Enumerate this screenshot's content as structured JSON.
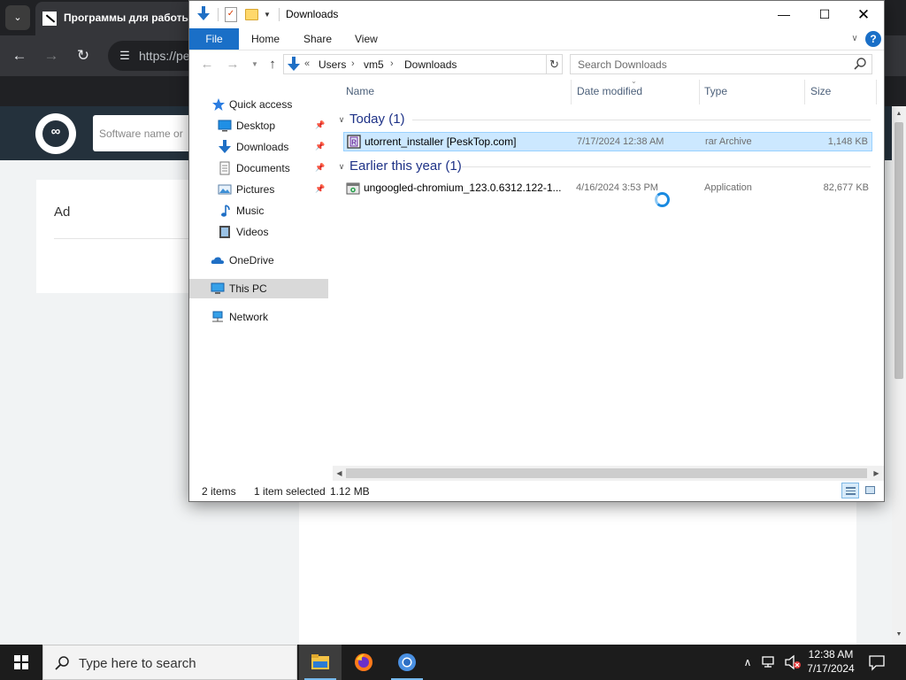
{
  "browser": {
    "tab_menu_glyph": "⌄",
    "tab_title": "Программы для работы с",
    "url": "https://pe",
    "site_search_placeholder": "Software name or",
    "ad_label": "Ad"
  },
  "explorer": {
    "title": "Downloads",
    "ribbon": {
      "file": "File",
      "home": "Home",
      "share": "Share",
      "view": "View",
      "help": "?"
    },
    "address": {
      "overflow": "«",
      "crumbs": [
        "Users",
        "vm5",
        "Downloads"
      ]
    },
    "search_placeholder": "Search Downloads",
    "nav": {
      "quick_access": "Quick access",
      "desktop": "Desktop",
      "downloads": "Downloads",
      "documents": "Documents",
      "pictures": "Pictures",
      "music": "Music",
      "videos": "Videos",
      "onedrive": "OneDrive",
      "this_pc": "This PC",
      "network": "Network"
    },
    "columns": {
      "name": "Name",
      "date": "Date modified",
      "type": "Type",
      "size": "Size"
    },
    "groups": [
      {
        "label": "Today (1)",
        "files": [
          {
            "name": "utorrent_installer [PeskTop.com]",
            "date": "7/17/2024 12:38 AM",
            "type": "rar Archive",
            "size": "1,148 KB",
            "icon": "rar-archive-icon",
            "selected": true
          }
        ]
      },
      {
        "label": "Earlier this year (1)",
        "files": [
          {
            "name": "ungoogled-chromium_123.0.6312.122-1....",
            "date": "4/16/2024 3:53 PM",
            "type": "Application",
            "size": "82,677 KB",
            "icon": "application-icon",
            "selected": false
          }
        ]
      }
    ],
    "status": {
      "items": "2 items",
      "selected": "1 item selected",
      "size": "1.12 MB"
    }
  },
  "taskbar": {
    "search_placeholder": "Type here to search",
    "apps": [
      "file-explorer-icon",
      "firefox-icon",
      "chromium-icon"
    ],
    "clock_time": "12:38 AM",
    "clock_date": "7/17/2024"
  },
  "colors": {
    "accent": "#1a6fc7",
    "selection": "#cce8ff",
    "taskbar": "#1c1c1c",
    "group_header": "#1e3287"
  }
}
